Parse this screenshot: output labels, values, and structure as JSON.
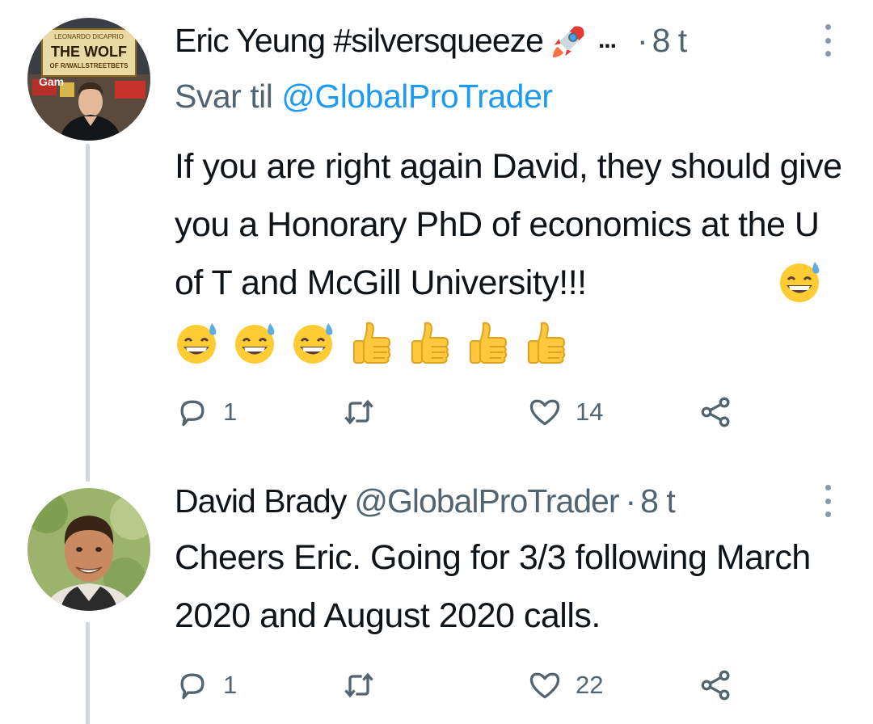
{
  "tweets": [
    {
      "author": "Eric Yeung #silversqueeze",
      "name_emoji": "rocket-emoji",
      "truncation": "...",
      "separator": "·",
      "time": "8 t",
      "reply_prefix": "Svar til",
      "reply_mention": "@GlobalProTrader",
      "text": "If you are right again David, they should give you a Honorary PhD of economics at the U of T and McGill University!!!",
      "trailing_emojis": [
        "grinning-sweat-emoji",
        "grinning-sweat-emoji",
        "grinning-sweat-emoji",
        "grinning-sweat-emoji",
        "thumbs-up-emoji",
        "thumbs-up-emoji",
        "thumbs-up-emoji",
        "thumbs-up-emoji"
      ],
      "avatar_poster": {
        "line1": "LEONARDO DICAPRIO",
        "line2": "THE WOLF",
        "line3": "OF R/WALLSTREETBETS",
        "store": "Gam"
      },
      "actions": {
        "replies": "1",
        "retweets": "",
        "likes": "14"
      }
    },
    {
      "author": "David Brady",
      "handle": "@GlobalProTrader",
      "separator": "·",
      "time": "8 t",
      "text": "Cheers Eric. Going for 3/3 following March 2020 and August 2020 calls.",
      "actions": {
        "replies": "1",
        "retweets": "",
        "likes": "22"
      }
    }
  ],
  "colors": {
    "text": "#0f1419",
    "secondary": "#536471",
    "link": "#1d9bf0",
    "thread_line": "#cfd9de"
  }
}
